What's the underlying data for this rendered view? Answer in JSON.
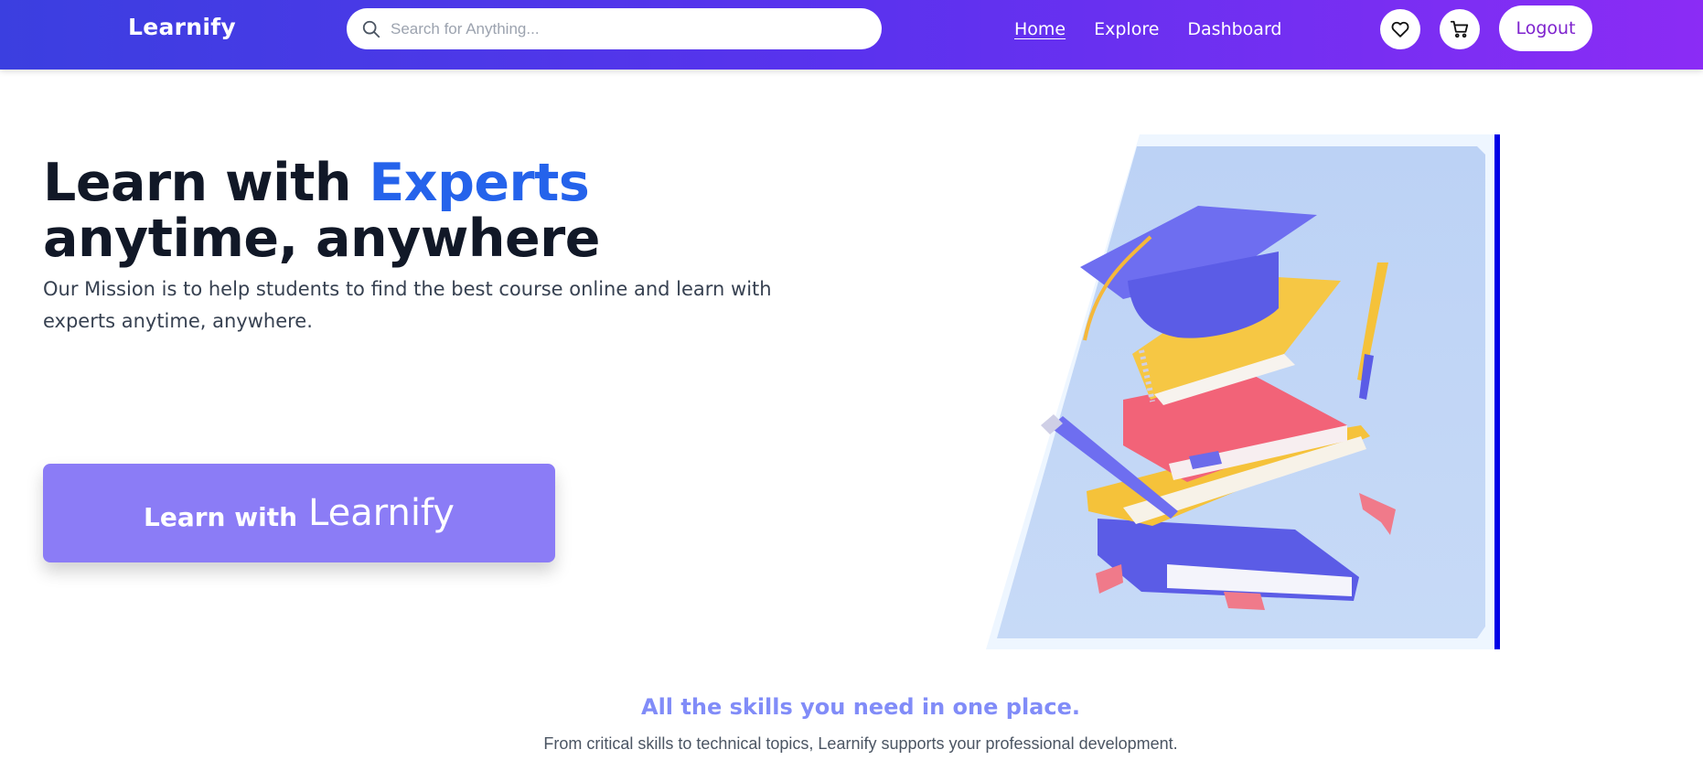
{
  "navbar": {
    "brand": "Learnify",
    "search": {
      "placeholder": "Search for Anything...",
      "value": "",
      "icon": "search-icon"
    },
    "links": [
      {
        "label": "Home",
        "active": true
      },
      {
        "label": "Explore",
        "active": false
      },
      {
        "label": "Dashboard",
        "active": false
      }
    ],
    "icons": [
      "heart-icon",
      "cart-icon"
    ],
    "logout_label": "Logout"
  },
  "hero": {
    "title_part1": "Learn with ",
    "title_accent": "Experts",
    "title_line2": "anytime, anywhere",
    "mission": "Our Mission is to help students to find the best course online and learn with experts anytime, anywhere.",
    "cta_prefix": "Learn with",
    "cta_brand": "Learnify"
  },
  "skills": {
    "title": "All the skills you need in one place.",
    "subtitle": "From critical skills to technical topics, Learnify supports your professional development."
  },
  "colors": {
    "nav_gradient_start": "#3b3fe0",
    "nav_gradient_end": "#8b2cf5",
    "accent_blue": "#2563eb",
    "cta_purple": "#8b7cf6",
    "logout_text": "#7e22ce",
    "skills_title": "#818cf8",
    "hero_bar": "#0000e6"
  }
}
